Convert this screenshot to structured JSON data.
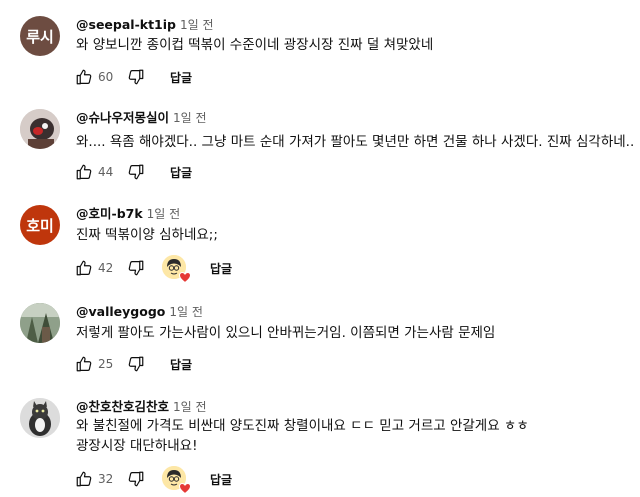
{
  "comments": [
    {
      "author": "@seepal-kt1ip",
      "time": "1일 전",
      "avatar_text": "루시",
      "text": "와 양보니깐 종이컵 떡볶이 수준이네 광장시장 진짜 덜 쳐맞았네",
      "likes": "60",
      "reply": "답글"
    },
    {
      "author": "@슈나우저몽실이",
      "time": "1일 전",
      "text": "와.... 욕좀 해야겠다.. 그냥 마트 순대 가져가 팔아도 몇년만 하면 건물 하나 사겠다.  진짜 심각하네..",
      "likes": "44",
      "reply": "답글"
    },
    {
      "author": "@호미-b7k",
      "time": "1일 전",
      "avatar_text": "호미",
      "text": "진짜 떡볶이양 심하네요;;",
      "likes": "42",
      "reply": "답글",
      "creator_heart": true
    },
    {
      "author": "@valleygogo",
      "time": "1일 전",
      "text": "저렇게 팔아도 가는사람이 있으니 안바뀌는거임. 이쯤되면 가는사람 문제임",
      "likes": "25",
      "reply": "답글"
    },
    {
      "author": "@찬호찬호김찬호",
      "time": "1일 전",
      "text": "와 불친절에 가격도 비싼대  양도진짜 창렬이내요 ㄷㄷ 믿고 거르고 안갈게요 ㅎㅎ",
      "text2": "광장시장 대단하내요!",
      "likes": "32",
      "reply": "답글",
      "creator_heart": true
    }
  ],
  "icons": {
    "like": "thumb-up-icon",
    "dislike": "thumb-down-icon",
    "heart": "heart-icon"
  },
  "colors": {
    "text": "#0f0f0f",
    "secondary": "#606060",
    "heart": "#e53935"
  }
}
